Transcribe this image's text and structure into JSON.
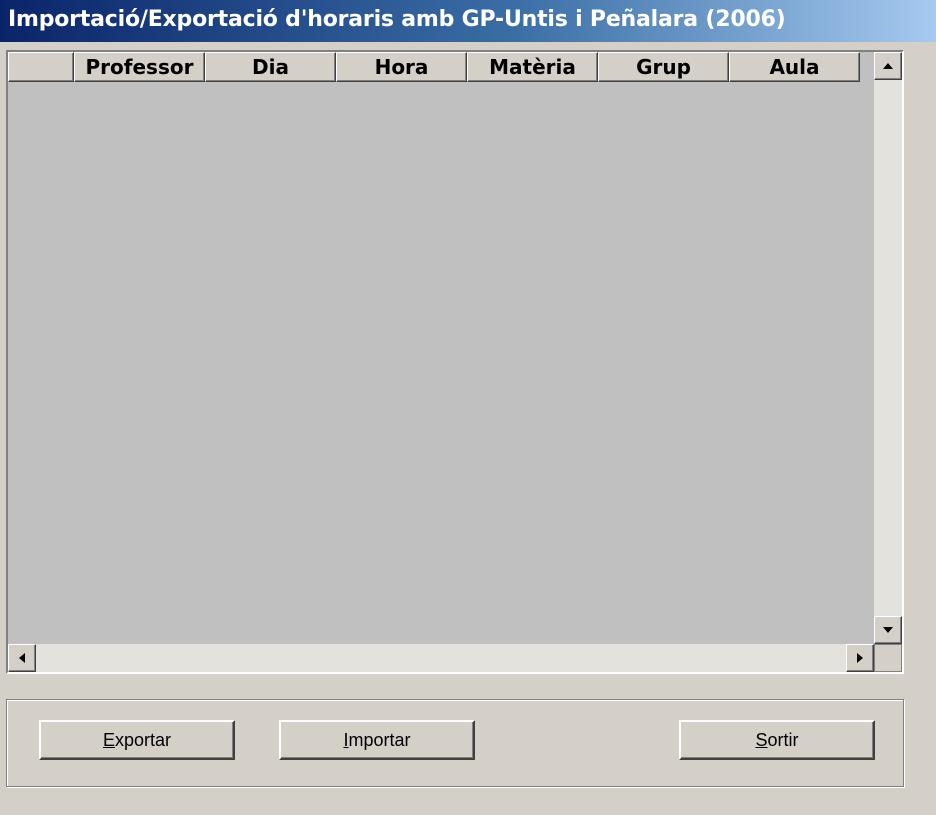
{
  "window": {
    "title": "Importació/Exportació d'horaris amb GP-Untis i Peñalara (2006)"
  },
  "grid": {
    "columns": [
      "",
      "Professor",
      "Dia",
      "Hora",
      "Matèria",
      "Grup",
      "Aula"
    ],
    "rows": []
  },
  "buttons": {
    "export": {
      "accel": "E",
      "rest": "xportar"
    },
    "import": {
      "accel": "I",
      "rest": "mportar"
    },
    "exit": {
      "accel": "S",
      "rest": "ortir"
    }
  },
  "icons": {
    "scroll_up": "arrow-up-icon",
    "scroll_down": "arrow-down-icon",
    "scroll_left": "arrow-left-icon",
    "scroll_right": "arrow-right-icon"
  }
}
